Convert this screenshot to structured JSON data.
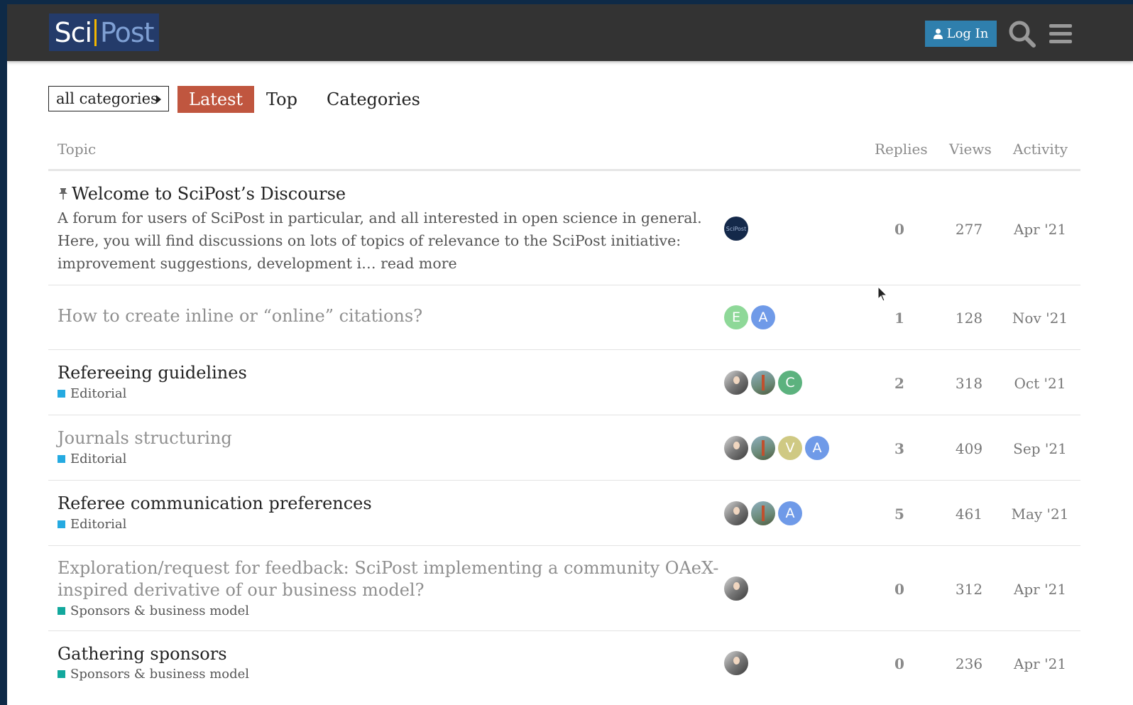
{
  "header": {
    "logo_sci": "Sci",
    "logo_post": "Post",
    "login_label": "Log In"
  },
  "nav": {
    "category_dropdown": "all categories",
    "tabs": [
      {
        "label": "Latest",
        "active": true
      },
      {
        "label": "Top",
        "active": false
      },
      {
        "label": "Categories",
        "active": false
      }
    ]
  },
  "columns": {
    "topic": "Topic",
    "replies": "Replies",
    "views": "Views",
    "activity": "Activity"
  },
  "topics": [
    {
      "title": "Welcome to SciPost’s Discourse",
      "pinned": true,
      "excerpt": "A forum for users of SciPost in particular, and all interested in open science in general. Here, you will find discussions on lots of topics of relevance to the SciPost initiative: improvement suggestions, development i…",
      "read_more": "read more",
      "replies": "0",
      "views": "277",
      "activity": "Apr '21"
    },
    {
      "title": "How to create inline or “online” citations?",
      "avatars": [
        "E",
        "A"
      ],
      "replies": "1",
      "views": "128",
      "activity": "Nov '21"
    },
    {
      "title": "Refereeing guidelines",
      "category": "Editorial",
      "avatars": [
        "C"
      ],
      "replies": "2",
      "views": "318",
      "activity": "Oct '21"
    },
    {
      "title": "Journals structuring",
      "category": "Editorial",
      "avatars": [
        "V",
        "A"
      ],
      "replies": "3",
      "views": "409",
      "activity": "Sep '21"
    },
    {
      "title": "Referee communication preferences",
      "category": "Editorial",
      "avatars": [
        "A"
      ],
      "replies": "5",
      "views": "461",
      "activity": "May '21"
    },
    {
      "title_line1": "Exploration/request for feedback: SciPost implementing a community OAeX-",
      "title_line2": "inspired derivative of our business model?",
      "category": "Sponsors & business model",
      "replies": "0",
      "views": "312",
      "activity": "Apr '21"
    },
    {
      "title": "Gathering sponsors",
      "category": "Sponsors & business model",
      "replies": "0",
      "views": "236",
      "activity": "Apr '21"
    }
  ],
  "colors": {
    "header_bg": "#333333",
    "active_tab": "#c0563f",
    "login_button": "#2f7fad",
    "editorial": "#25aae1",
    "sponsors": "#12a89d",
    "avatar_e": "#8ed898",
    "avatar_a": "#6f9ae8",
    "avatar_c": "#5cb27e",
    "avatar_v": "#cfc983"
  }
}
